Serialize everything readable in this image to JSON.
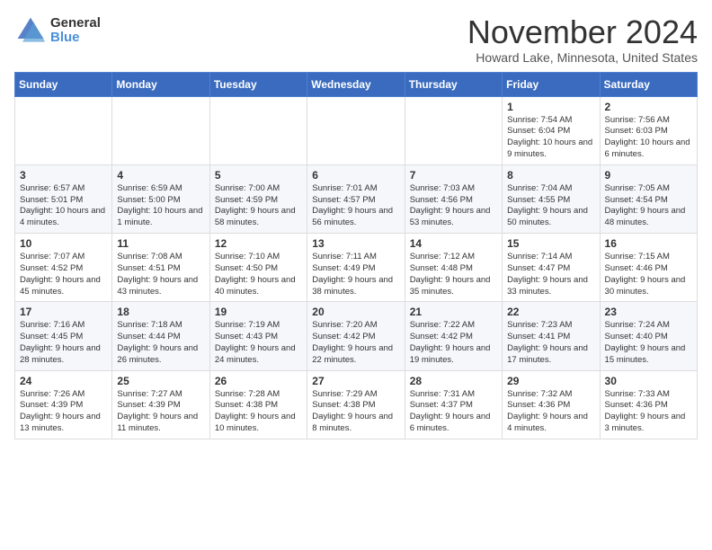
{
  "logo": {
    "general": "General",
    "blue": "Blue"
  },
  "title": "November 2024",
  "location": "Howard Lake, Minnesota, United States",
  "days_of_week": [
    "Sunday",
    "Monday",
    "Tuesday",
    "Wednesday",
    "Thursday",
    "Friday",
    "Saturday"
  ],
  "weeks": [
    [
      {
        "day": "",
        "info": ""
      },
      {
        "day": "",
        "info": ""
      },
      {
        "day": "",
        "info": ""
      },
      {
        "day": "",
        "info": ""
      },
      {
        "day": "",
        "info": ""
      },
      {
        "day": "1",
        "info": "Sunrise: 7:54 AM\nSunset: 6:04 PM\nDaylight: 10 hours\nand 9 minutes."
      },
      {
        "day": "2",
        "info": "Sunrise: 7:56 AM\nSunset: 6:03 PM\nDaylight: 10 hours\nand 6 minutes."
      }
    ],
    [
      {
        "day": "3",
        "info": "Sunrise: 6:57 AM\nSunset: 5:01 PM\nDaylight: 10 hours\nand 4 minutes."
      },
      {
        "day": "4",
        "info": "Sunrise: 6:59 AM\nSunset: 5:00 PM\nDaylight: 10 hours\nand 1 minute."
      },
      {
        "day": "5",
        "info": "Sunrise: 7:00 AM\nSunset: 4:59 PM\nDaylight: 9 hours\nand 58 minutes."
      },
      {
        "day": "6",
        "info": "Sunrise: 7:01 AM\nSunset: 4:57 PM\nDaylight: 9 hours\nand 56 minutes."
      },
      {
        "day": "7",
        "info": "Sunrise: 7:03 AM\nSunset: 4:56 PM\nDaylight: 9 hours\nand 53 minutes."
      },
      {
        "day": "8",
        "info": "Sunrise: 7:04 AM\nSunset: 4:55 PM\nDaylight: 9 hours\nand 50 minutes."
      },
      {
        "day": "9",
        "info": "Sunrise: 7:05 AM\nSunset: 4:54 PM\nDaylight: 9 hours\nand 48 minutes."
      }
    ],
    [
      {
        "day": "10",
        "info": "Sunrise: 7:07 AM\nSunset: 4:52 PM\nDaylight: 9 hours\nand 45 minutes."
      },
      {
        "day": "11",
        "info": "Sunrise: 7:08 AM\nSunset: 4:51 PM\nDaylight: 9 hours\nand 43 minutes."
      },
      {
        "day": "12",
        "info": "Sunrise: 7:10 AM\nSunset: 4:50 PM\nDaylight: 9 hours\nand 40 minutes."
      },
      {
        "day": "13",
        "info": "Sunrise: 7:11 AM\nSunset: 4:49 PM\nDaylight: 9 hours\nand 38 minutes."
      },
      {
        "day": "14",
        "info": "Sunrise: 7:12 AM\nSunset: 4:48 PM\nDaylight: 9 hours\nand 35 minutes."
      },
      {
        "day": "15",
        "info": "Sunrise: 7:14 AM\nSunset: 4:47 PM\nDaylight: 9 hours\nand 33 minutes."
      },
      {
        "day": "16",
        "info": "Sunrise: 7:15 AM\nSunset: 4:46 PM\nDaylight: 9 hours\nand 30 minutes."
      }
    ],
    [
      {
        "day": "17",
        "info": "Sunrise: 7:16 AM\nSunset: 4:45 PM\nDaylight: 9 hours\nand 28 minutes."
      },
      {
        "day": "18",
        "info": "Sunrise: 7:18 AM\nSunset: 4:44 PM\nDaylight: 9 hours\nand 26 minutes."
      },
      {
        "day": "19",
        "info": "Sunrise: 7:19 AM\nSunset: 4:43 PM\nDaylight: 9 hours\nand 24 minutes."
      },
      {
        "day": "20",
        "info": "Sunrise: 7:20 AM\nSunset: 4:42 PM\nDaylight: 9 hours\nand 22 minutes."
      },
      {
        "day": "21",
        "info": "Sunrise: 7:22 AM\nSunset: 4:42 PM\nDaylight: 9 hours\nand 19 minutes."
      },
      {
        "day": "22",
        "info": "Sunrise: 7:23 AM\nSunset: 4:41 PM\nDaylight: 9 hours\nand 17 minutes."
      },
      {
        "day": "23",
        "info": "Sunrise: 7:24 AM\nSunset: 4:40 PM\nDaylight: 9 hours\nand 15 minutes."
      }
    ],
    [
      {
        "day": "24",
        "info": "Sunrise: 7:26 AM\nSunset: 4:39 PM\nDaylight: 9 hours\nand 13 minutes."
      },
      {
        "day": "25",
        "info": "Sunrise: 7:27 AM\nSunset: 4:39 PM\nDaylight: 9 hours\nand 11 minutes."
      },
      {
        "day": "26",
        "info": "Sunrise: 7:28 AM\nSunset: 4:38 PM\nDaylight: 9 hours\nand 10 minutes."
      },
      {
        "day": "27",
        "info": "Sunrise: 7:29 AM\nSunset: 4:38 PM\nDaylight: 9 hours\nand 8 minutes."
      },
      {
        "day": "28",
        "info": "Sunrise: 7:31 AM\nSunset: 4:37 PM\nDaylight: 9 hours\nand 6 minutes."
      },
      {
        "day": "29",
        "info": "Sunrise: 7:32 AM\nSunset: 4:36 PM\nDaylight: 9 hours\nand 4 minutes."
      },
      {
        "day": "30",
        "info": "Sunrise: 7:33 AM\nSunset: 4:36 PM\nDaylight: 9 hours\nand 3 minutes."
      }
    ]
  ]
}
